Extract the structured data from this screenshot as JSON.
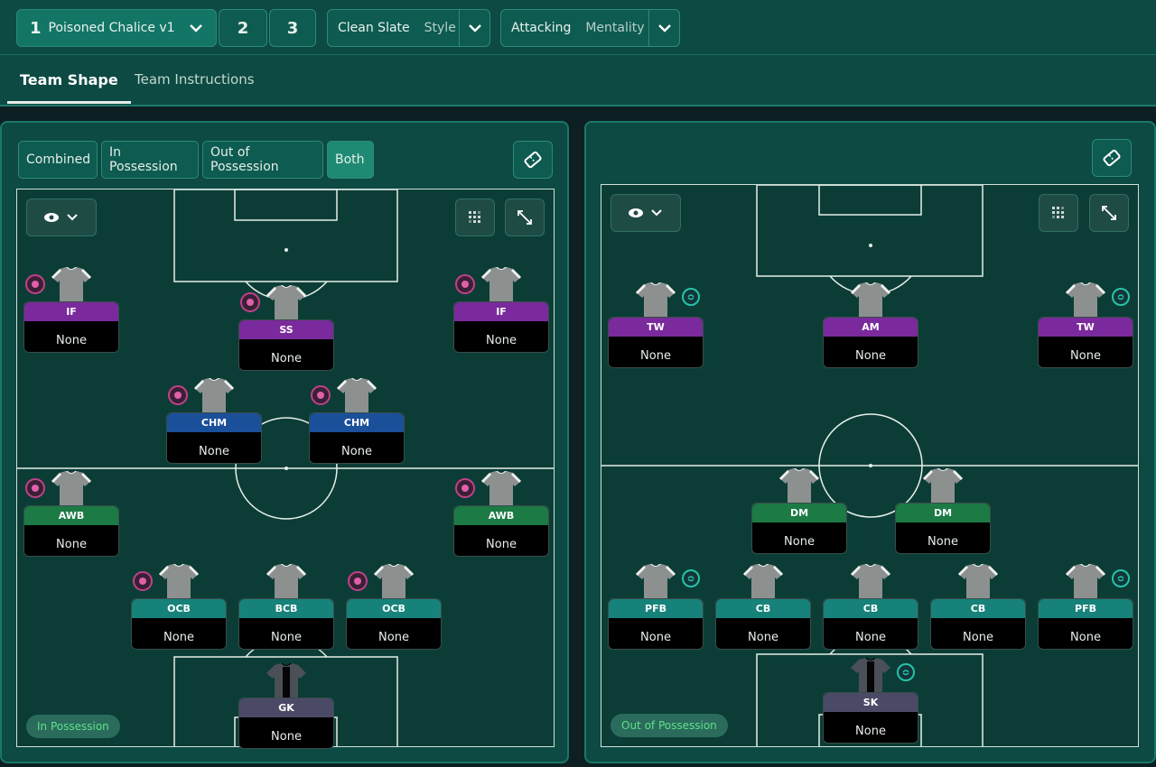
{
  "toolbar": {
    "tactic_slot_1": "1",
    "tactic_name": "Poisoned Chalice v1",
    "tactic_slot_2": "2",
    "tactic_slot_3": "3",
    "style_value": "Clean Slate",
    "style_label": "Style",
    "mentality_value": "Attacking",
    "mentality_label": "Mentality"
  },
  "tabs": [
    "Team Shape",
    "Team Instructions"
  ],
  "left_panel": {
    "segments": [
      "Combined",
      "In Possession",
      "Out of Possession",
      "Both"
    ],
    "active_segment": "Both",
    "pill": "In Possession",
    "players": [
      {
        "role": "IF",
        "duty": "None",
        "color": "#7a2a9c"
      },
      {
        "role": "SS",
        "duty": "None",
        "color": "#7a2a9c"
      },
      {
        "role": "IF",
        "duty": "None",
        "color": "#7a2a9c"
      },
      {
        "role": "CHM",
        "duty": "None",
        "color": "#1a4f9a"
      },
      {
        "role": "CHM",
        "duty": "None",
        "color": "#1a4f9a"
      },
      {
        "role": "AWB",
        "duty": "None",
        "color": "#1c7a45"
      },
      {
        "role": "AWB",
        "duty": "None",
        "color": "#1c7a45"
      },
      {
        "role": "OCB",
        "duty": "None",
        "color": "#17827a"
      },
      {
        "role": "BCB",
        "duty": "None",
        "color": "#17827a"
      },
      {
        "role": "OCB",
        "duty": "None",
        "color": "#17827a"
      },
      {
        "role": "GK",
        "duty": "None",
        "color": "#4b4a66"
      }
    ]
  },
  "right_panel": {
    "pill": "Out of Possession",
    "players": [
      {
        "role": "TW",
        "duty": "None",
        "color": "#7a2a9c"
      },
      {
        "role": "AM",
        "duty": "None",
        "color": "#7a2a9c"
      },
      {
        "role": "TW",
        "duty": "None",
        "color": "#7a2a9c"
      },
      {
        "role": "DM",
        "duty": "None",
        "color": "#1c7a45"
      },
      {
        "role": "DM",
        "duty": "None",
        "color": "#1c7a45"
      },
      {
        "role": "PFB",
        "duty": "None",
        "color": "#17827a"
      },
      {
        "role": "CB",
        "duty": "None",
        "color": "#17827a"
      },
      {
        "role": "CB",
        "duty": "None",
        "color": "#17827a"
      },
      {
        "role": "CB",
        "duty": "None",
        "color": "#17827a"
      },
      {
        "role": "PFB",
        "duty": "None",
        "color": "#17827a"
      },
      {
        "role": "SK",
        "duty": "None",
        "color": "#4b4a66"
      }
    ]
  },
  "icons": {
    "tactic_dropdown": "chevron-down-icon",
    "visibility": "eye-icon",
    "grid": "grid-icon",
    "expand": "expand-icon",
    "settings": "ticket-icon"
  }
}
